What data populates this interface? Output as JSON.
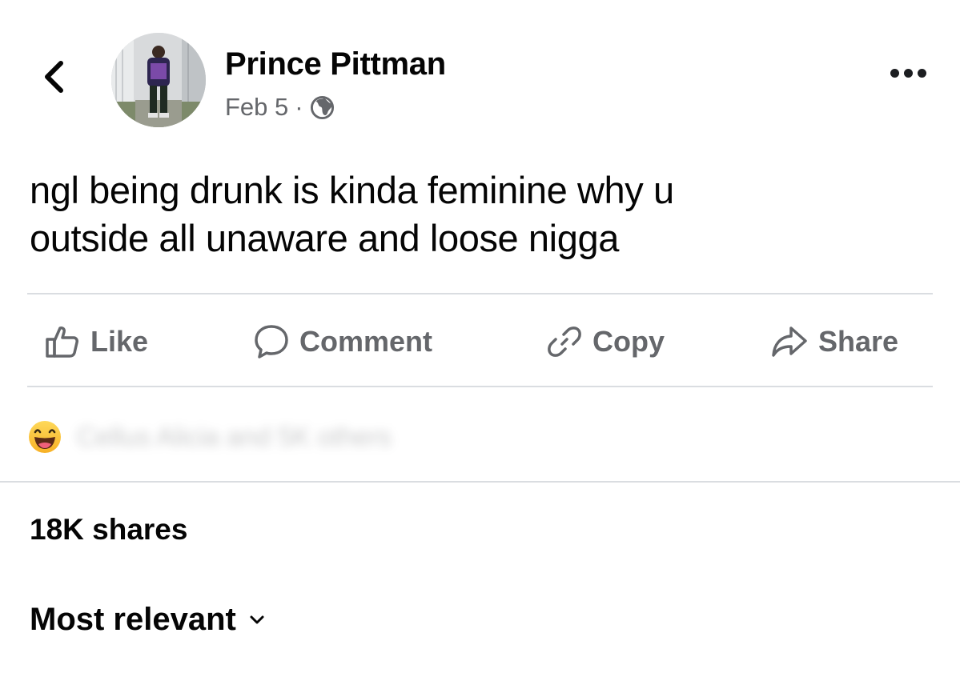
{
  "post": {
    "author_name": "Prince Pittman",
    "date": "Feb 5",
    "separator": "·",
    "audience_icon": "globe-icon",
    "text_line1": "ngl being drunk is kinda feminine why u",
    "text_line2": "outside all unaware and loose nigga"
  },
  "actions": {
    "like": "Like",
    "comment": "Comment",
    "copy": "Copy",
    "share": "Share"
  },
  "reactions": {
    "icon": "haha-reaction-icon",
    "summary": "Cellus Alicia and 5K others"
  },
  "stats": {
    "shares": "18K shares"
  },
  "comments": {
    "sort_label": "Most relevant"
  },
  "colors": {
    "primary_text": "#050505",
    "secondary_text": "#65676b",
    "divider": "#dadde1",
    "reaction_yellow": "#f7b125"
  }
}
